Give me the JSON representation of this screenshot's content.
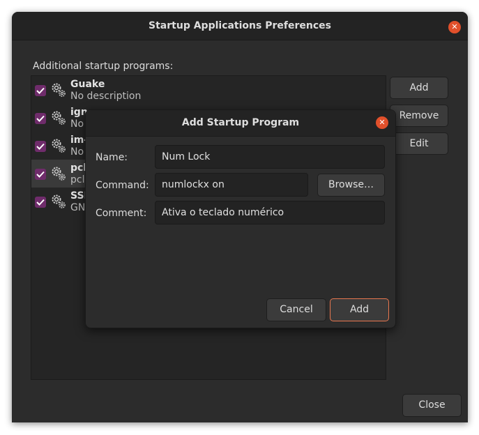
{
  "window": {
    "title": "Startup Applications Preferences",
    "close_glyph": "✕",
    "section_label": "Additional startup programs:",
    "programs": [
      {
        "name": "Guake",
        "description": "No description",
        "checked": true
      },
      {
        "name": "ign",
        "description": "No",
        "checked": true
      },
      {
        "name": "im-",
        "description": "No",
        "checked": true
      },
      {
        "name": "pcl",
        "description": "pcl",
        "checked": true
      },
      {
        "name": "SSI",
        "description": "GN",
        "checked": true
      }
    ],
    "buttons": {
      "add": "Add",
      "remove": "Remove",
      "edit": "Edit",
      "close": "Close"
    }
  },
  "dialog": {
    "title": "Add Startup Program",
    "close_glyph": "✕",
    "name_label": "Name:",
    "name_value": "Num Lock",
    "command_label": "Command:",
    "command_value": "numlockx on",
    "comment_label": "Comment:",
    "comment_value": "Ativa o teclado numérico",
    "browse_label": "Browse…",
    "cancel_label": "Cancel",
    "add_label": "Add"
  },
  "colors": {
    "accent": "#e9774f",
    "checkbox": "#6f2c6b",
    "close_button": "#e1502b"
  }
}
